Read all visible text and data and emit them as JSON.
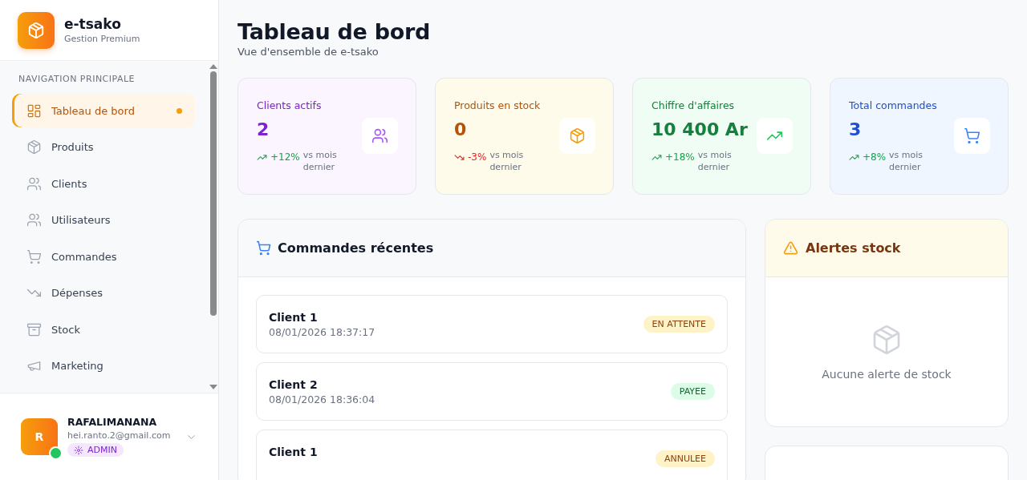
{
  "brand": {
    "name": "e-tsako",
    "subtitle": "Gestion Premium"
  },
  "sidebar": {
    "section_title": "NAVIGATION PRINCIPALE",
    "items": [
      {
        "label": "Tableau de bord",
        "selected": true
      },
      {
        "label": "Produits",
        "selected": false
      },
      {
        "label": "Clients",
        "selected": false
      },
      {
        "label": "Utilisateurs",
        "selected": false
      },
      {
        "label": "Commandes",
        "selected": false
      },
      {
        "label": "Dépenses",
        "selected": false
      },
      {
        "label": "Stock",
        "selected": false
      },
      {
        "label": "Marketing",
        "selected": false
      }
    ]
  },
  "user": {
    "initial": "R",
    "name": "RAFALIMANANA",
    "email": "hei.ranto.2@gmail.com",
    "role": "ADMIN",
    "online": true
  },
  "header": {
    "title": "Tableau de bord",
    "subtitle": "Vue d'ensemble de e-tsako"
  },
  "stats": [
    {
      "label": "Clients actifs",
      "value": "2",
      "change": "+12%",
      "kind": "up",
      "note": "vs mois dernier",
      "color": "#7e22ce"
    },
    {
      "label": "Produits en stock",
      "value": "0",
      "change": "-3%",
      "kind": "down",
      "note": "vs mois dernier",
      "color": "#b45309"
    },
    {
      "label": "Chiffre d'affaires",
      "value": "10 400 Ar",
      "change": "+18%",
      "kind": "up",
      "note": "vs mois dernier",
      "color": "#15803d"
    },
    {
      "label": "Total commandes",
      "value": "3",
      "change": "+8%",
      "kind": "up",
      "note": "vs mois dernier",
      "color": "#1d4ed8"
    }
  ],
  "recent_orders": {
    "title": "Commandes récentes",
    "orders": [
      {
        "client": "Client 1",
        "date": "08/01/2026 18:37:17",
        "status": "EN ATTENTE",
        "kind": "pending"
      },
      {
        "client": "Client 2",
        "date": "08/01/2026 18:36:04",
        "status": "PAYEE",
        "kind": "paid"
      },
      {
        "client": "Client 1",
        "status": "ANNULEE",
        "kind": "cancelled"
      }
    ]
  },
  "stock_alerts": {
    "title": "Alertes stock",
    "empty_message": "Aucune alerte de stock"
  }
}
